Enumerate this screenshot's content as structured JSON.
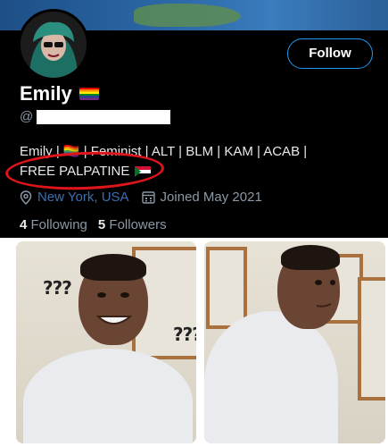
{
  "profile": {
    "name": "Emily",
    "handle_prefix": "@",
    "follow_button": "Follow",
    "bio_line1": "Emily | 🏳️‍🌈 | Feminist | ALT | BLM | KAM | ACAB |",
    "bio_line2": "FREE PALPATINE",
    "location": "New York, USA",
    "joined": "Joined May 2021",
    "following_count": "4",
    "following_label": "Following",
    "followers_count": "5",
    "followers_label": "Followers"
  },
  "meme": {
    "question_marks_left_1": "???",
    "question_marks_left_2": "???"
  },
  "colors": {
    "follow_border": "#1d9bf0",
    "annotation_circle": "#e0151b",
    "secondary_text": "#8b98a5"
  }
}
